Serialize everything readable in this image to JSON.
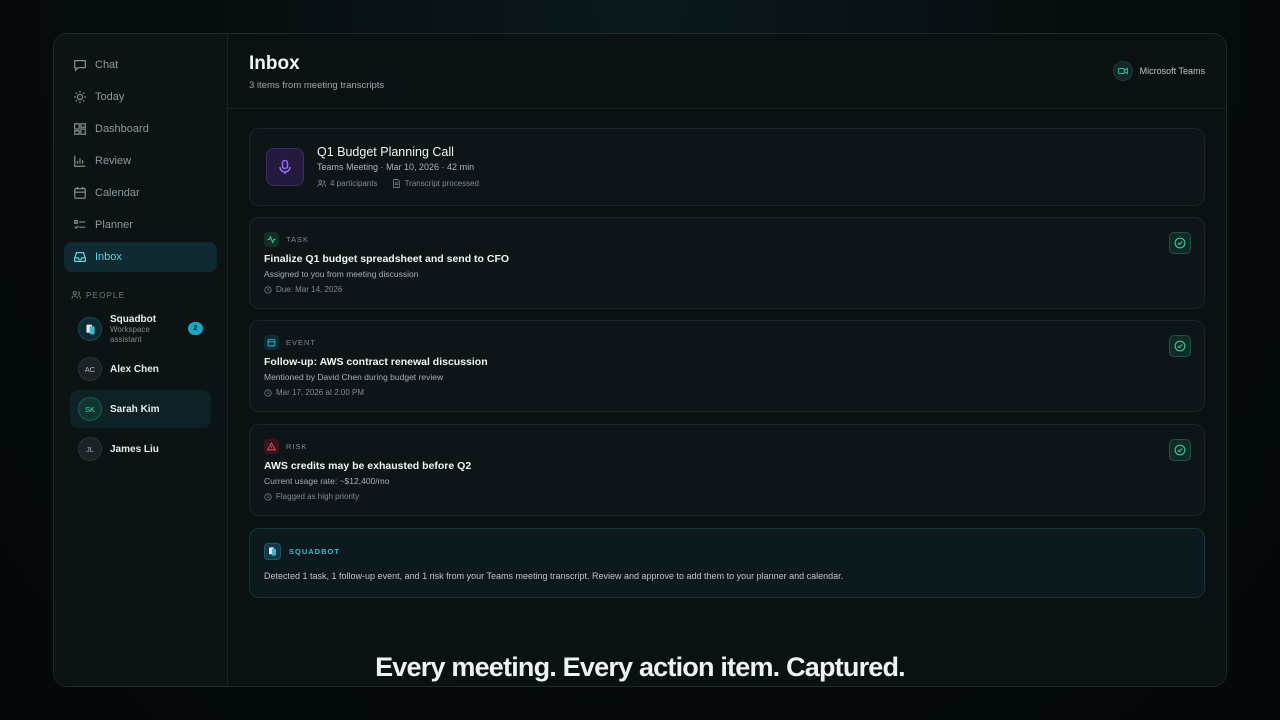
{
  "sidebar": {
    "nav": [
      {
        "label": "Chat",
        "icon": "chat-icon"
      },
      {
        "label": "Today",
        "icon": "sun-icon"
      },
      {
        "label": "Dashboard",
        "icon": "dashboard-icon"
      },
      {
        "label": "Review",
        "icon": "bar-chart-icon"
      },
      {
        "label": "Calendar",
        "icon": "calendar-icon"
      },
      {
        "label": "Planner",
        "icon": "planner-icon"
      },
      {
        "label": "Inbox",
        "icon": "inbox-icon",
        "active": true
      }
    ],
    "people_label": "PEOPLE",
    "people": [
      {
        "name": "Squadbot",
        "subtitle_line1": "Workspace",
        "subtitle_line2": "assistant",
        "badge": "2",
        "icon": "squadbot-logo-icon"
      },
      {
        "name": "Alex Chen",
        "initials": "AC"
      },
      {
        "name": "Sarah Kim",
        "initials": "SK",
        "selected": true
      },
      {
        "name": "James Liu",
        "initials": "JL"
      }
    ]
  },
  "header": {
    "title": "Inbox",
    "subtitle": "3 items from meeting transcripts",
    "integration": "Microsoft Teams"
  },
  "meeting": {
    "title": "Q1 Budget Planning Call",
    "meta": "Teams Meeting · Mar 10, 2026 · 42 min",
    "participants": "4 participants",
    "status": "Transcript processed"
  },
  "items": [
    {
      "type": "TASK",
      "title": "Finalize Q1 budget spreadsheet and send to CFO",
      "description": "Assigned to you from meeting discussion",
      "meta": "Due: Mar 14, 2026"
    },
    {
      "type": "EVENT",
      "title": "Follow-up: AWS contract renewal discussion",
      "description": "Mentioned by David Chen during budget review",
      "meta": "Mar 17, 2026 at 2:00 PM"
    },
    {
      "type": "RISK",
      "title": "AWS credits may be exhausted before Q2",
      "description": "Current usage rate: ~$12,400/mo",
      "meta": "Flagged as high priority"
    }
  ],
  "bot_summary": {
    "label": "SQUADBOT",
    "message": "Detected 1 task, 1 follow-up event, and 1 risk from your Teams meeting transcript. Review and approve to add them to your planner and calendar."
  },
  "caption": "Every meeting. Every action item. Captured.",
  "colors": {
    "accent": "#5fd3e4",
    "task": "#3fd49a",
    "event": "#3fb7d4",
    "risk": "#e05560",
    "meeting": "#8e6bf0"
  }
}
